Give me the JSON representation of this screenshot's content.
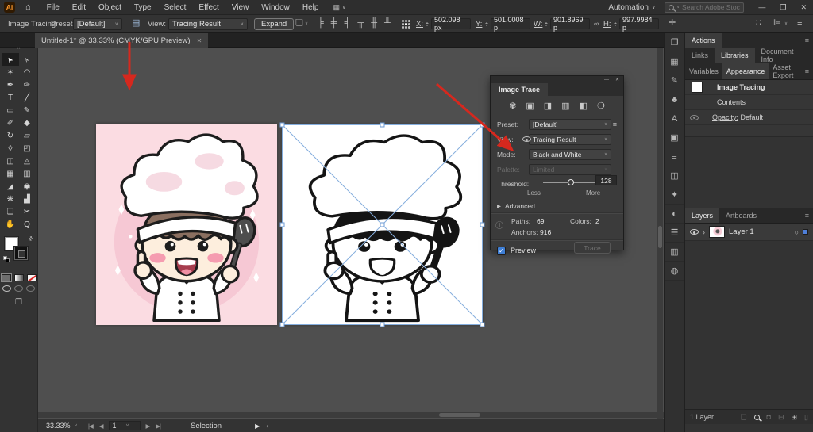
{
  "colors": {
    "accent_red": "#d6281e",
    "selection_blue": "#85aede",
    "artboard_pink": "#fbdce2",
    "layer_chip_blue": "#4f7fd9",
    "checkbox_blue": "#3f7fd6"
  },
  "icons": {
    "home": "⌂",
    "workspace-switcher": "▦",
    "chevron-down": "∨",
    "minimize": "—",
    "restore": "❐",
    "close": "✕",
    "panel-toggle": "▤",
    "document-setup": "❏",
    "link": "∞",
    "transform": "✛",
    "grid-options": "∷",
    "align-options": "⊫",
    "panel-menu": "≡",
    "advanced-expander": "▶",
    "info": "ⓘ",
    "check": "✓",
    "layer-chevron": "›",
    "layer-target": "○",
    "first-artboard": "|◀",
    "prev-artboard": "◀",
    "next-artboard": "▶",
    "last-artboard": "▶|",
    "play": "▶",
    "collapse-left": "‹",
    "collect-export": "❏",
    "mask": "◘",
    "new-sublayer": "⊟",
    "new-layer": "⊞",
    "delete": "▯",
    "swap-fill-stroke": "⇄",
    "screen-mode": "❐",
    "more-tools": "…"
  },
  "app_bar": {
    "logo": "Ai",
    "menus": [
      "File",
      "Edit",
      "Object",
      "Type",
      "Select",
      "Effect",
      "View",
      "Window",
      "Help"
    ],
    "workspace_label": "Automation",
    "search_placeholder": "Search Adobe Stock"
  },
  "control_bar": {
    "panel_title": "Image Tracing",
    "preset_label": "Preset:",
    "preset_value": "[Default]",
    "view_label": "View:",
    "view_value": "Tracing Result",
    "expand_button": "Expand",
    "align_tools": [
      {
        "name": "align-left",
        "glyph": "╞"
      },
      {
        "name": "align-center",
        "glyph": "╪"
      },
      {
        "name": "align-right",
        "glyph": "╡"
      },
      {
        "name": "align-top",
        "glyph": "╥"
      },
      {
        "name": "align-middle",
        "glyph": "╫"
      },
      {
        "name": "align-bottom",
        "glyph": "╨"
      }
    ],
    "x_label": "X:",
    "x_value": "502.098 px",
    "y_label": "Y:",
    "y_value": "501.0008 p",
    "w_label": "W:",
    "w_value": "901.8969 p",
    "h_label": "H:",
    "h_value": "997.9984 p"
  },
  "document_tab": {
    "title": "Untitled-1* @ 33.33% (CMYK/GPU Preview)"
  },
  "toolbar": {
    "tools": [
      {
        "name": "selection",
        "glyph": "➤",
        "cls": "rot-nw",
        "active": true
      },
      {
        "name": "direct-selection",
        "glyph": "➢",
        "cls": "rot-nw"
      },
      {
        "name": "magic-wand",
        "glyph": "✶"
      },
      {
        "name": "lasso",
        "glyph": "◠"
      },
      {
        "name": "pen",
        "glyph": "✒"
      },
      {
        "name": "curvature",
        "glyph": "✑"
      },
      {
        "name": "type",
        "glyph": "T"
      },
      {
        "name": "line-segment",
        "glyph": "╱"
      },
      {
        "name": "rectangle",
        "glyph": "▭"
      },
      {
        "name": "paintbrush",
        "glyph": "✎"
      },
      {
        "name": "pencil",
        "glyph": "✐"
      },
      {
        "name": "eraser",
        "glyph": "◆"
      },
      {
        "name": "rotate",
        "glyph": "↻"
      },
      {
        "name": "scale",
        "glyph": "▱"
      },
      {
        "name": "width",
        "glyph": "◊"
      },
      {
        "name": "free-transform",
        "glyph": "◰"
      },
      {
        "name": "shape-builder",
        "glyph": "◫"
      },
      {
        "name": "perspective-grid",
        "glyph": "◬"
      },
      {
        "name": "mesh",
        "glyph": "▦"
      },
      {
        "name": "gradient",
        "glyph": "▥"
      },
      {
        "name": "eyedropper",
        "glyph": "◢"
      },
      {
        "name": "blend",
        "glyph": "◉"
      },
      {
        "name": "symbol-sprayer",
        "glyph": "❋"
      },
      {
        "name": "column-graph",
        "glyph": "▟"
      },
      {
        "name": "artboard",
        "glyph": "❏"
      },
      {
        "name": "slice",
        "glyph": "✂"
      },
      {
        "name": "hand",
        "glyph": "✋"
      },
      {
        "name": "zoom",
        "glyph": "Q"
      }
    ]
  },
  "trace_panel": {
    "title": "Image Trace",
    "mode_icons": [
      {
        "name": "auto-color",
        "glyph": "✾"
      },
      {
        "name": "high-color",
        "glyph": "▣"
      },
      {
        "name": "low-color",
        "glyph": "◨"
      },
      {
        "name": "grayscale",
        "glyph": "▥"
      },
      {
        "name": "black-and-white",
        "glyph": "◧"
      },
      {
        "name": "outline",
        "glyph": "❍"
      }
    ],
    "preset_label": "Preset:",
    "preset_value": "[Default]",
    "view_label": "View:",
    "view_value": "Tracing Result",
    "mode_label": "Mode:",
    "mode_value": "Black and White",
    "palette_label": "Palette:",
    "palette_value": "Limited",
    "threshold_label": "Threshold:",
    "threshold_value": "128",
    "threshold_min_label": "Less",
    "threshold_max_label": "More",
    "advanced_label": "Advanced",
    "info": {
      "paths_label": "Paths:",
      "paths_value": "69",
      "anchors_label": "Anchors:",
      "anchors_value": "916",
      "colors_label": "Colors:",
      "colors_value": "2"
    },
    "preview_label": "Preview",
    "trace_button": "Trace"
  },
  "dock_panels": [
    {
      "name": "artboards",
      "glyph": "❐"
    },
    {
      "name": "swatches",
      "glyph": "▦"
    },
    {
      "name": "brushes",
      "glyph": "✎"
    },
    {
      "name": "symbols",
      "glyph": "♣"
    },
    {
      "name": "glyphs",
      "glyph": "A"
    },
    {
      "name": "transform",
      "glyph": "▣"
    },
    {
      "name": "align",
      "glyph": "≡"
    },
    {
      "name": "pathfinder",
      "glyph": "◫"
    },
    {
      "name": "color",
      "glyph": "✦"
    },
    {
      "name": "color-guide",
      "glyph": "◐"
    },
    {
      "name": "stroke",
      "glyph": "☰"
    },
    {
      "name": "gradient",
      "glyph": "▥"
    },
    {
      "name": "transparency",
      "glyph": "◍"
    }
  ],
  "right_panels": {
    "actions_tab": "Actions",
    "links_tab": "Links",
    "libraries_tab": "Libraries",
    "document_info_tab": "Document Info",
    "variables_tab": "Variables",
    "appearance_tab": "Appearance",
    "asset_export_tab": "Asset Export",
    "appearance_item": "Image Tracing",
    "appearance_contents": "Contents",
    "opacity_label": "Opacity:",
    "opacity_value": "Default",
    "layers_tab": "Layers",
    "artboards_tab": "Artboards",
    "layer_name": "Layer 1",
    "layers_count": "1 Layer"
  },
  "status_bar": {
    "zoom": "33.33%",
    "artboard_number": "1",
    "mode": "Selection"
  }
}
